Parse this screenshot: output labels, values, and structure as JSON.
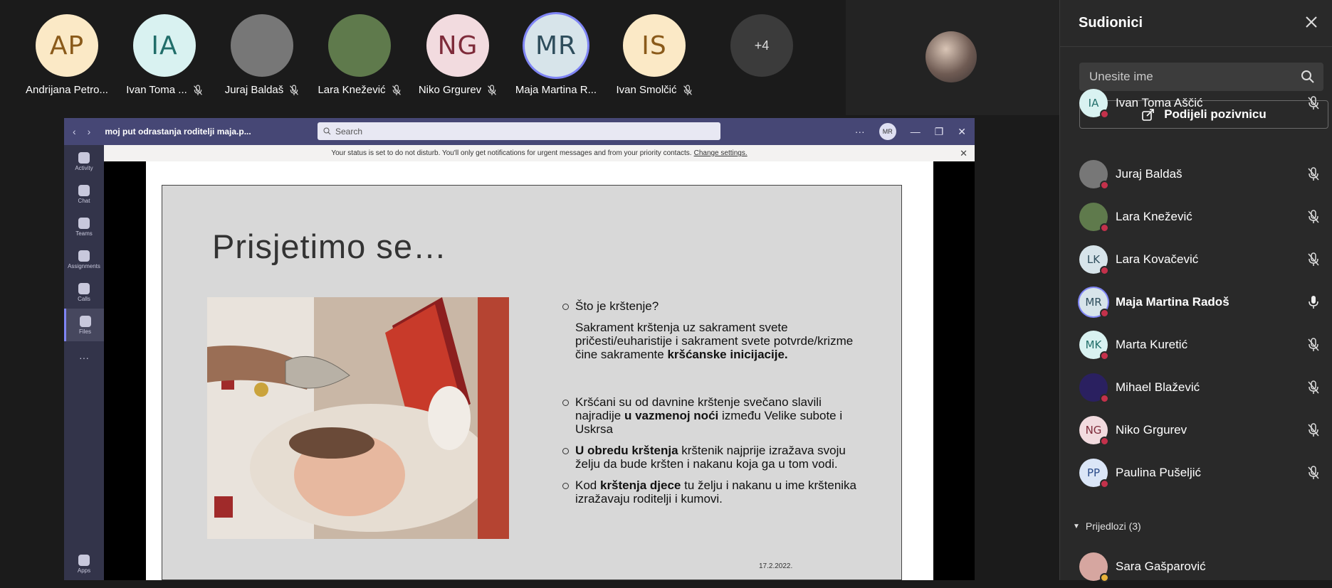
{
  "gallery": {
    "tiles": [
      {
        "initials": "AP",
        "name": "Andrijana Petro...",
        "bg": "#fbe9c6",
        "fg": "#8a5a1a",
        "muted": false
      },
      {
        "initials": "IA",
        "name": "Ivan Toma ...",
        "bg": "#d9f2f1",
        "fg": "#216e6a",
        "muted": true
      },
      {
        "initials": "",
        "name": "Juraj Baldaš",
        "bg": "#777",
        "fg": "#fff",
        "muted": true
      },
      {
        "initials": "",
        "name": "Lara Knežević",
        "bg": "#5f7a4c",
        "fg": "#fff",
        "muted": true
      },
      {
        "initials": "NG",
        "name": "Niko Grgurev",
        "bg": "#f2dbdf",
        "fg": "#7e2b3a",
        "muted": true
      },
      {
        "initials": "MR",
        "name": "Maja Martina R...",
        "bg": "#d7e4ea",
        "fg": "#2e4d5c",
        "muted": false
      },
      {
        "initials": "IS",
        "name": "Ivan Smolčić",
        "bg": "#fbe9c6",
        "fg": "#8a5a1a",
        "muted": true
      }
    ],
    "more_label": "+4"
  },
  "teams_window": {
    "title": "moj put odrastanja roditelji maja.p...",
    "search_placeholder": "Search",
    "me_initials": "MR",
    "notice": "Your status is set to do not disturb. You'll only get notifications for urgent messages and from your priority contacts.",
    "notice_link": "Change settings.",
    "rail": [
      {
        "label": "Activity"
      },
      {
        "label": "Chat"
      },
      {
        "label": "Teams"
      },
      {
        "label": "Assignments"
      },
      {
        "label": "Calls"
      },
      {
        "label": "Files"
      },
      {
        "label": "..."
      },
      {
        "label": "Apps"
      }
    ]
  },
  "slide": {
    "title": "Prisjetimo se…",
    "q1": "Što je krštenje?",
    "p1_a": "Sakrament krštenja uz sakrament svete pričesti/euharistije i sakrament svete potvrde/krizme čine sakramente ",
    "p1_b": "kršćanske inicijacije.",
    "b2_a": "Kršćani su od davnine krštenje svečano slavili najradije ",
    "b2_b": "u vazmenoj noći",
    "b2_c": " između Velike subote i Uskrsa",
    "b3_a": "U obredu krštenja",
    "b3_b": " krštenik najprije izražava svoju želju da bude kršten i nakanu koja ga u tom vodi.",
    "b4_a": "Kod ",
    "b4_b": "krštenja djece",
    "b4_c": " tu želju i nakanu u ime krštenika izražavaju roditelji i kumovi.",
    "date": "17.2.2022."
  },
  "panel": {
    "title": "Sudionici",
    "search_placeholder": "Unesite ime",
    "invite_label": "Podijeli pozivnicu",
    "participants": [
      {
        "initials": "IA",
        "name": "Ivan Toma Aščić",
        "bg": "#d9f2f1",
        "fg": "#216e6a",
        "mic": "off",
        "bold": false
      },
      {
        "initials": "",
        "name": "Juraj Baldaš",
        "bg": "#777",
        "fg": "#fff",
        "mic": "off",
        "bold": false
      },
      {
        "initials": "",
        "name": "Lara Knežević",
        "bg": "#5f7a4c",
        "fg": "#fff",
        "mic": "off",
        "bold": false
      },
      {
        "initials": "LK",
        "name": "Lara Kovačević",
        "bg": "#d7e4ea",
        "fg": "#2e4d5c",
        "mic": "off",
        "bold": false
      },
      {
        "initials": "MR",
        "name": "Maja Martina Radoš",
        "bg": "#d7e4ea",
        "fg": "#2e4d5c",
        "mic": "on",
        "bold": true
      },
      {
        "initials": "MK",
        "name": "Marta Kuretić",
        "bg": "#d9f2f1",
        "fg": "#216e6a",
        "mic": "off",
        "bold": false
      },
      {
        "initials": "",
        "name": "Mihael Blažević",
        "bg": "#2a2060",
        "fg": "#fff",
        "mic": "off",
        "bold": false
      },
      {
        "initials": "NG",
        "name": "Niko Grgurev",
        "bg": "#f2dbdf",
        "fg": "#7e2b3a",
        "mic": "off",
        "bold": false
      },
      {
        "initials": "PP",
        "name": "Paulina Pušeljić",
        "bg": "#dbe6f7",
        "fg": "#2b4c8a",
        "mic": "off",
        "bold": false
      }
    ],
    "suggestions_label": "Prijedlozi (3)",
    "suggestion": {
      "name": "Sara Gašparović"
    }
  }
}
